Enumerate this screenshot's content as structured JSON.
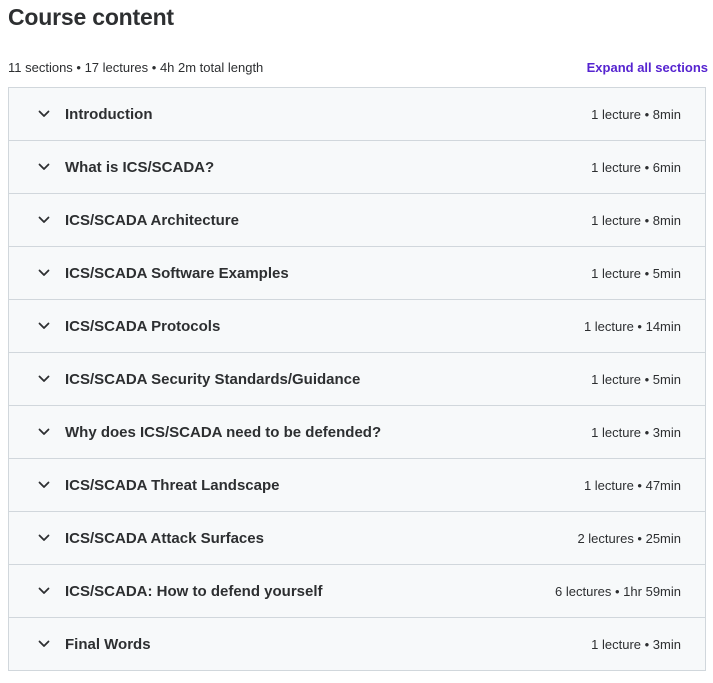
{
  "header": {
    "title": "Course content",
    "summary": "11 sections • 17 lectures • 4h 2m total length",
    "expand_label": "Expand all sections"
  },
  "sections": [
    {
      "title": "Introduction",
      "meta": "1 lecture • 8min"
    },
    {
      "title": "What is ICS/SCADA?",
      "meta": "1 lecture • 6min"
    },
    {
      "title": "ICS/SCADA Architecture",
      "meta": "1 lecture • 8min"
    },
    {
      "title": "ICS/SCADA Software Examples",
      "meta": "1 lecture • 5min"
    },
    {
      "title": "ICS/SCADA Protocols",
      "meta": "1 lecture • 14min"
    },
    {
      "title": "ICS/SCADA Security Standards/Guidance",
      "meta": "1 lecture • 5min"
    },
    {
      "title": "Why does ICS/SCADA need to be defended?",
      "meta": "1 lecture • 3min"
    },
    {
      "title": "ICS/SCADA Threat Landscape",
      "meta": "1 lecture • 47min"
    },
    {
      "title": "ICS/SCADA Attack Surfaces",
      "meta": "2 lectures • 25min"
    },
    {
      "title": "ICS/SCADA: How to defend yourself",
      "meta": "6 lectures • 1hr 59min"
    },
    {
      "title": "Final Words",
      "meta": "1 lecture • 3min"
    }
  ],
  "icons": {
    "section_toggle": "chevron-down-icon"
  },
  "colors": {
    "accent": "#5624d0",
    "row_background": "#f7f9fa",
    "border": "#d1d7dc",
    "text": "#2d2f31"
  }
}
